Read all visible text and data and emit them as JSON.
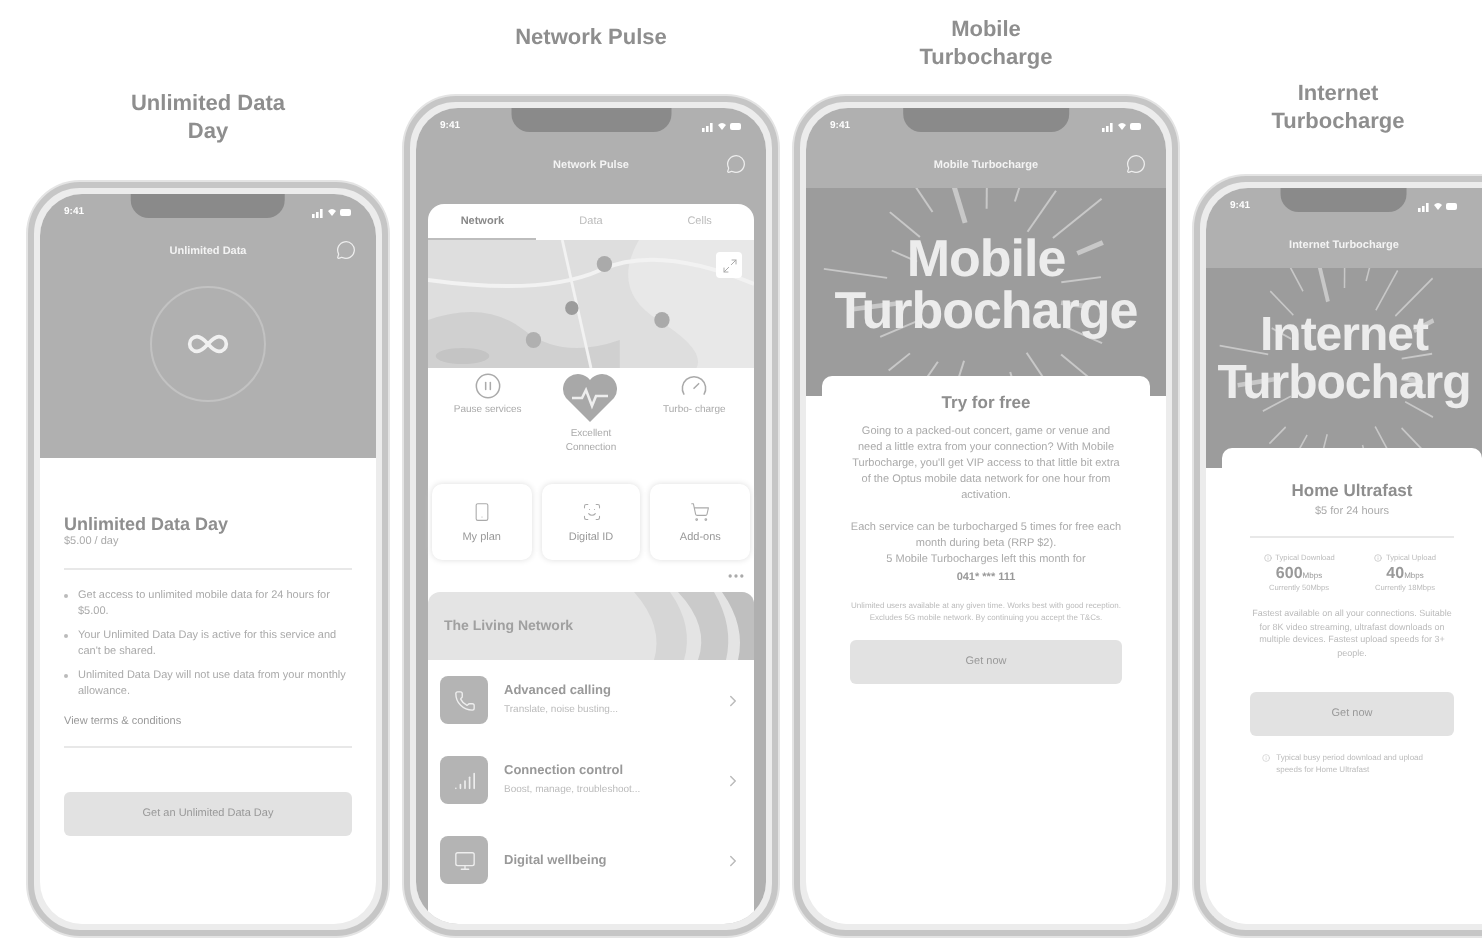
{
  "phones": [
    {
      "kind": "data_day",
      "caption": "Unlimited Data Day",
      "time": "9:41",
      "header": "Unlimited Data",
      "title": "Unlimited Data Day",
      "price": "$5.00 / day",
      "bullets": [
        "Get access to unlimited mobile data for 24 hours for $5.00.",
        "Your Unlimited Data Day is active for this service and can't be shared.",
        "Unlimited Data Day will not use data from your monthly allowance."
      ],
      "link": "View terms & conditions",
      "button": "Get an Unlimited Data Day"
    },
    {
      "kind": "pulse",
      "caption": "Network Pulse",
      "time": "9:41",
      "header": "Network Pulse",
      "tabs": [
        {
          "label": "Network",
          "selected": true
        },
        {
          "label": "Data",
          "selected": false
        },
        {
          "label": "Cells",
          "selected": false
        }
      ],
      "actions": [
        {
          "kind": "pause",
          "label": "Pause services"
        },
        {
          "kind": "heart",
          "label": "Excellent Connection"
        },
        {
          "kind": "gauge",
          "label": "Turbo- charge"
        }
      ],
      "shortcuts": [
        {
          "kind": "plan",
          "label": "My plan"
        },
        {
          "kind": "id",
          "label": "Digital ID"
        },
        {
          "kind": "addons",
          "label": "Add-ons"
        }
      ],
      "banner": "The Living Network",
      "features": [
        {
          "kind": "calling",
          "title": "Advanced calling",
          "subtitle": "Translate, noise busting..."
        },
        {
          "kind": "control",
          "title": "Connection control",
          "subtitle": "Boost, manage, troubleshoot..."
        },
        {
          "kind": "wellbeing",
          "title": "Digital wellbeing"
        }
      ]
    },
    {
      "kind": "turbo",
      "caption": "Mobile Turbocharge",
      "time": "9:41",
      "header": "Mobile Turbocharge",
      "hero": [
        "Mobile",
        "Turbocharge"
      ],
      "card_title": "Try for free",
      "paragraphs": [
        "Going to a packed-out concert, game or venue and need a little extra from your connection? With Mobile Turbocharge, you'll get VIP access to that little bit extra of the Optus mobile data network for one hour from activation.",
        "Each service can be turbocharged 5 times for free each month during beta (RRP $2)."
      ],
      "remaining": "5 Mobile Turbocharges left this month for",
      "number": "041* *** 111",
      "fine_print": "Unlimited users available at any given time. Works best with good reception. Excludes 5G mobile network. By continuing you accept the T&Cs.",
      "button": "Get now"
    },
    {
      "kind": "internet",
      "caption": "Internet Turbocharge",
      "time": "9:41",
      "header": "Internet Turbocharge",
      "hero": [
        "Internet",
        "Turbocharg"
      ],
      "plan": "Home Ultrafast",
      "price": "$5 for 24 hours",
      "speeds": [
        {
          "label": "Typical Download",
          "value": "600",
          "unit": "Mbps",
          "note": "Currently 50Mbps"
        },
        {
          "label": "Typical Upload",
          "value": "40",
          "unit": "Mbps",
          "note": "Currently 18Mbps"
        }
      ],
      "description": "Fastest available on all your connections. Suitable for 8K video streaming, ultrafast downloads on multiple devices. Fastest upload speeds for 3+ people.",
      "button": "Get now",
      "footnote": "Typical busy period download and upload speeds for Home Ultrafast"
    }
  ]
}
